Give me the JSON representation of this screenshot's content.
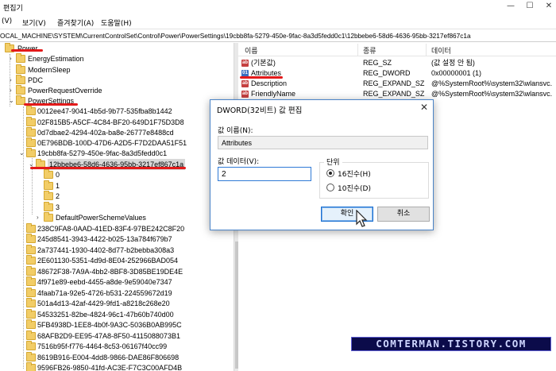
{
  "window": {
    "title": "편집기"
  },
  "menu": [
    "(V)",
    "보기(V)",
    "즐겨찾기(A)",
    "도움말(H)"
  ],
  "address": "OCAL_MACHINE\\SYSTEM\\CurrentControlSet\\Control\\Power\\PowerSettings\\19cbb8fa-5279-450e-9fac-8a3d5fedd0c1\\12bbebe6-58d6-4636-95bb-3217ef867c1a",
  "tree": {
    "top": [
      "Power",
      "EnergyEstimation",
      "ModernSleep",
      "PDC",
      "PowerRequestOverride",
      "PowerSettings"
    ],
    "settings_before": [
      "0012ee47-9041-4b5d-9b77-535fba8b1442",
      "02F815B5-A5CF-4C84-BF20-649D1F75D3D8",
      "0d7dbae2-4294-402a-ba8e-26777e8488cd",
      "0E796BDB-100D-47D6-A2D5-F7D2DAA51F51"
    ],
    "expanded_setting": "19cbb8fa-5279-450e-9fac-8a3d5fedd0c1",
    "selected_key": "12bbebe6-58d6-4636-95bb-3217ef867c1a",
    "subkeys": [
      "0",
      "1",
      "2",
      "3",
      "DefaultPowerSchemeValues"
    ],
    "settings_after": [
      "238C9FA8-0AAD-41ED-83F4-97BE242C8F20",
      "245d8541-3943-4422-b025-13a784f679b7",
      "2a737441-1930-4402-8d77-b2bebba308a3",
      "2E601130-5351-4d9d-8E04-252966BAD054",
      "48672F38-7A9A-4bb2-8BF8-3D85BE19DE4E",
      "4f971e89-eebd-4455-a8de-9e59040e7347",
      "4faab71a-92e5-4726-b531-224559672d19",
      "501a4d13-42af-4429-9fd1-a8218c268e20",
      "54533251-82be-4824-96c1-47b60b740d00",
      "5FB4938D-1EE8-4b0f-9A3C-5036B0AB995C",
      "68AFB2D9-EE95-47A8-8F50-4115088073B1",
      "7516b95f-f776-4464-8c53-06167f40cc99",
      "8619B916-E004-4dd8-9866-DAE86F806698",
      "9596FB26-9850-41fd-AC3E-F7C3C00AFD4B"
    ]
  },
  "list": {
    "headers": [
      "이름",
      "종류",
      "데이터"
    ],
    "rows": [
      {
        "name": "(기본값)",
        "type": "REG_SZ",
        "data": "(값 설정 안 됨)",
        "icon": "string-value-icon"
      },
      {
        "name": "Attributes",
        "type": "REG_DWORD",
        "data": "0x00000001 (1)",
        "icon": "dword-value-icon"
      },
      {
        "name": "Description",
        "type": "REG_EXPAND_SZ",
        "data": "@%SystemRoot%\\system32\\wlansvc.",
        "icon": "string-value-icon"
      },
      {
        "name": "FriendlyName",
        "type": "REG_EXPAND_SZ",
        "data": "@%SystemRoot%\\system32\\wlansvc.",
        "icon": "string-value-icon"
      }
    ]
  },
  "dialog": {
    "title": "DWORD(32비트) 값 편집",
    "close": "✕",
    "name_label": "값 이름(N):",
    "name_value": "Attributes",
    "data_label": "값 데이터(V):",
    "data_value": "2",
    "base_label": "단위",
    "hex_label": "16진수(H)",
    "dec_label": "10진수(D)",
    "selected_base": "hex",
    "ok": "확인",
    "cancel": "취소"
  },
  "watermark": "COMTERMAN.TISTORY.COM",
  "colors": {
    "highlight": "#e31a1a",
    "folder": "#f2cd67",
    "dialog_border": "#4b84c7",
    "watermark_bg": "#0b0b4a"
  }
}
